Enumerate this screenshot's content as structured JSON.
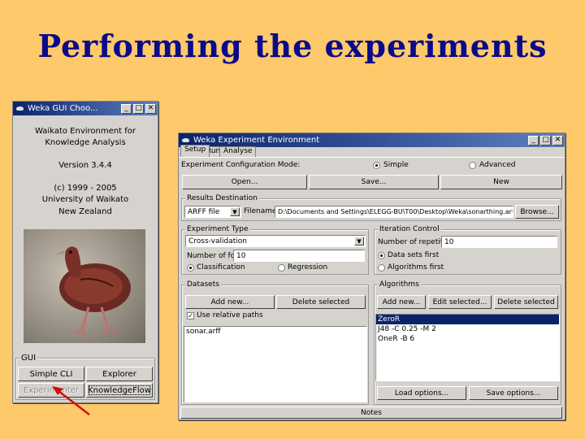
{
  "slide": {
    "title": "Performing the experiments"
  },
  "gui_chooser": {
    "title": "Weka GUI Choo...",
    "about": [
      "Waikato Environment for",
      "Knowledge Analysis",
      "Version 3.4.4",
      "(c) 1999 - 2005",
      "University of Waikato",
      "New Zealand"
    ],
    "group_label": "GUI",
    "buttons": {
      "simple_cli": "Simple CLI",
      "explorer": "Explorer",
      "experimenter": "Experimenter",
      "knowledge_flow": "KnowledgeFlow"
    }
  },
  "experiment_env": {
    "title": "Weka Experiment Environment",
    "tabs": [
      "Setup",
      "Run",
      "Analyse"
    ],
    "config_mode_label": "Experiment Configuration Mode:",
    "mode_simple": "Simple",
    "mode_advanced": "Advanced",
    "open": "Open...",
    "save": "Save...",
    "new": "New",
    "results_destination": {
      "label": "Results Destination",
      "type": "ARFF file",
      "filename_label": "Filename:",
      "filename": "D:\\Documents and Settings\\ELEGG-BU\\T00\\Desktop\\Weka\\sonarthing.arff",
      "browse": "Browse..."
    },
    "experiment_type": {
      "label": "Experiment Type",
      "type": "Cross-validation",
      "folds_label": "Number of folds:",
      "folds": "10",
      "classification": "Classification",
      "regression": "Regression"
    },
    "iteration_control": {
      "label": "Iteration Control",
      "repetitions_label": "Number of repetitions:",
      "repetitions": "10",
      "data_first": "Data sets first",
      "algorithms_first": "Algorithms first"
    },
    "datasets": {
      "label": "Datasets",
      "add_new": "Add new...",
      "delete_selected": "Delete selected",
      "use_relative": "Use relative paths",
      "items": [
        "sonar.arff"
      ]
    },
    "algorithms": {
      "label": "Algorithms",
      "add_new": "Add new...",
      "edit_selected": "Edit selected...",
      "delete_selected": "Delete selected",
      "items": [
        "ZeroR",
        "J48 -C 0.25 -M 2",
        "OneR -B 6"
      ],
      "load_options": "Load options...",
      "save_options": "Save options..."
    },
    "notes": "Notes"
  },
  "colors": {
    "background": "#fdc96a",
    "title": "#0a0a8a",
    "window": "#d6d3ce",
    "titlebar": "#0a246a",
    "arrow": "#cc1010"
  }
}
